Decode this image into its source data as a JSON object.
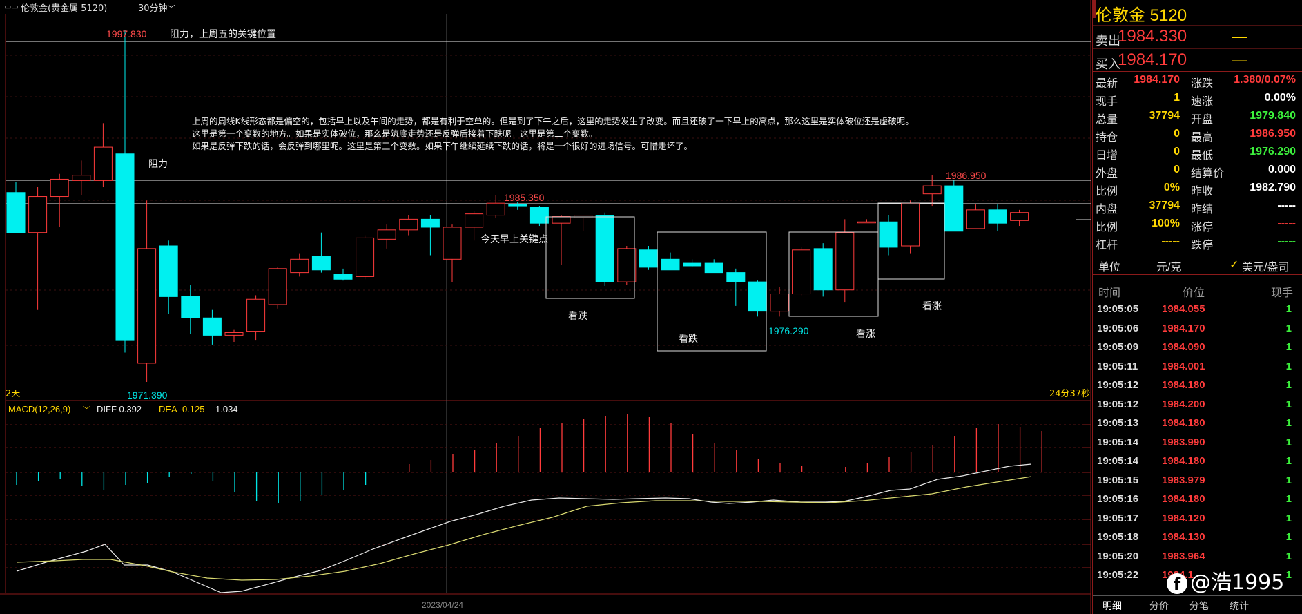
{
  "header": {
    "instrument_label": "伦敦金(贵金属  5120)",
    "period_label": "30分钟",
    "period_chevron_icon": "chevron-down-icon"
  },
  "main_chart": {
    "high_label": "1997.830",
    "low_label": "1971.390",
    "mid_high_label": "1985.350",
    "right_high_label": "1986.950",
    "right_low_label": "1976.290",
    "top_annotation": "阻力，上周五的关键位置",
    "resistance_label": "阻力",
    "key_point_label": "今天早上关键点",
    "bearish_label": "看跌",
    "bullish_label": "看涨",
    "commentary": [
      "上周的周线K线形态都是偏空的，包括早上以及午间的走势，都是有利于空单的。但是到了下午之后，这里的走势发生了改变。而且还破了一下早上的高点，那么这里是实体破位还是虚破呢。",
      "这里是第一个变数的地方。如果是实体破位，那么是筑底走势还是反弹后接着下跌呢。这里是第二个变数。",
      "如果是反弹下跌的话，会反弹到哪里呢。这里是第三个变数。如果下午继续延续下跌的话，将是一个很好的进场信号。可惜走坏了。"
    ],
    "left_bottom_label": "2天",
    "right_bottom_label": "24分37秒",
    "date_label": "2023/04/24",
    "colors": {
      "up": "#ff3b3b",
      "down": "#00f0f0",
      "text_red": "#ff4a4a",
      "text_cyan": "#00e5e5"
    }
  },
  "macd": {
    "title": "MACD(12,26,9)",
    "diff_label": "DIFF 0.392",
    "dea_label": "DEA -0.125",
    "macd_value": "1.034",
    "chevron_icon": "chevron-down-icon"
  },
  "side": {
    "title": "伦敦金  5120",
    "sell_label": "卖出",
    "sell_price": "1984.330",
    "sell_vol": "—",
    "buy_label": "买入",
    "buy_price": "1984.170",
    "buy_vol": "—",
    "quotes": [
      {
        "l1": "最新",
        "v1": "1984.170",
        "c1": "#ff3b3b",
        "l2": "涨跌",
        "v2": "1.380/0.07%",
        "c2": "#ff3b3b"
      },
      {
        "l1": "现手",
        "v1": "1",
        "c1": "#ffd700",
        "l2": "速涨",
        "v2": "0.00%",
        "c2": "#ffffff"
      },
      {
        "l1": "总量",
        "v1": "37794",
        "c1": "#ffd700",
        "l2": "开盘",
        "v2": "1979.840",
        "c2": "#3cf03c"
      },
      {
        "l1": "持仓",
        "v1": "0",
        "c1": "#ffd700",
        "l2": "最高",
        "v2": "1986.950",
        "c2": "#ff3b3b"
      },
      {
        "l1": "日增",
        "v1": "0",
        "c1": "#ffd700",
        "l2": "最低",
        "v2": "1976.290",
        "c2": "#3cf03c"
      },
      {
        "l1": "外盘",
        "v1": "0",
        "c1": "#ffd700",
        "l2": "结算价",
        "v2": "0.000",
        "c2": "#ffffff"
      },
      {
        "l1": "比例",
        "v1": "0%",
        "c1": "#ffd700",
        "l2": "昨收",
        "v2": "1982.790",
        "c2": "#ffffff"
      },
      {
        "l1": "内盘",
        "v1": "37794",
        "c1": "#ffd700",
        "l2": "昨结",
        "v2": "-----",
        "c2": "#ffffff"
      },
      {
        "l1": "比例",
        "v1": "100%",
        "c1": "#ffd700",
        "l2": "涨停",
        "v2": "-----",
        "c2": "#ff3b3b"
      },
      {
        "l1": "杠杆",
        "v1": "-----",
        "c1": "#ffd700",
        "l2": "跌停",
        "v2": "-----",
        "c2": "#3cf03c"
      }
    ],
    "unit_label": "单位",
    "unit_value": "元/克",
    "unit_check_icon": "checkmark-icon",
    "unit_alt": "美元/盎司",
    "tick_header": {
      "time": "时间",
      "price": "价位",
      "vol": "现手"
    },
    "ticks": [
      {
        "time": "19:05:05",
        "price": "1984.055",
        "vol": "1"
      },
      {
        "time": "19:05:06",
        "price": "1984.170",
        "vol": "1"
      },
      {
        "time": "19:05:09",
        "price": "1984.090",
        "vol": "1"
      },
      {
        "time": "19:05:11",
        "price": "1984.001",
        "vol": "1"
      },
      {
        "time": "19:05:12",
        "price": "1984.180",
        "vol": "1"
      },
      {
        "time": "19:05:12",
        "price": "1984.200",
        "vol": "1"
      },
      {
        "time": "19:05:13",
        "price": "1984.180",
        "vol": "1"
      },
      {
        "time": "19:05:14",
        "price": "1983.990",
        "vol": "1"
      },
      {
        "time": "19:05:14",
        "price": "1984.180",
        "vol": "1"
      },
      {
        "time": "19:05:15",
        "price": "1983.979",
        "vol": "1"
      },
      {
        "time": "19:05:16",
        "price": "1984.180",
        "vol": "1"
      },
      {
        "time": "19:05:17",
        "price": "1984.120",
        "vol": "1"
      },
      {
        "time": "19:05:18",
        "price": "1984.130",
        "vol": "1"
      },
      {
        "time": "19:05:20",
        "price": "1983.964",
        "vol": "1"
      },
      {
        "time": "19:05:22",
        "price": "1984.1",
        "vol": "1"
      }
    ],
    "tabs": [
      "明细",
      "分价",
      "分笔",
      "统计"
    ]
  },
  "watermark": {
    "icon": "facebook-icon",
    "text": "@浩1995"
  },
  "chart_data": {
    "type": "candlestick",
    "title": "",
    "timeframe": "30分钟",
    "ylim": [
      1970,
      1999
    ],
    "date_tick": "2023/04/24",
    "candles": [
      {
        "o": 1985.6,
        "h": 1986.4,
        "l": 1983.9,
        "c": 1982.6
      },
      {
        "o": 1982.6,
        "h": 1986.0,
        "l": 1976.8,
        "c": 1985.3
      },
      {
        "o": 1985.3,
        "h": 1987.0,
        "l": 1983.0,
        "c": 1986.6
      },
      {
        "o": 1986.5,
        "h": 1988.0,
        "l": 1985.4,
        "c": 1986.9
      },
      {
        "o": 1986.5,
        "h": 1990.8,
        "l": 1986.0,
        "c": 1989.0
      },
      {
        "o": 1988.5,
        "h": 1997.8,
        "l": 1973.6,
        "c": 1974.5
      },
      {
        "o": 1972.8,
        "h": 1985.0,
        "l": 1971.4,
        "c": 1981.4
      },
      {
        "o": 1981.6,
        "h": 1982.0,
        "l": 1976.5,
        "c": 1977.8
      },
      {
        "o": 1977.8,
        "h": 1978.7,
        "l": 1975.0,
        "c": 1976.2
      },
      {
        "o": 1976.2,
        "h": 1976.8,
        "l": 1974.2,
        "c": 1974.9
      },
      {
        "o": 1974.9,
        "h": 1975.3,
        "l": 1974.4,
        "c": 1975.1
      },
      {
        "o": 1975.2,
        "h": 1977.9,
        "l": 1974.5,
        "c": 1977.6
      },
      {
        "o": 1977.2,
        "h": 1980.0,
        "l": 1976.9,
        "c": 1979.9
      },
      {
        "o": 1979.6,
        "h": 1981.0,
        "l": 1979.3,
        "c": 1980.6
      },
      {
        "o": 1980.8,
        "h": 1982.6,
        "l": 1979.6,
        "c": 1979.8
      },
      {
        "o": 1979.5,
        "h": 1979.9,
        "l": 1979.0,
        "c": 1979.1
      },
      {
        "o": 1979.3,
        "h": 1982.4,
        "l": 1979.1,
        "c": 1982.2
      },
      {
        "o": 1982.1,
        "h": 1983.2,
        "l": 1981.4,
        "c": 1982.8
      },
      {
        "o": 1982.8,
        "h": 1983.9,
        "l": 1982.4,
        "c": 1983.6
      },
      {
        "o": 1983.6,
        "h": 1983.9,
        "l": 1980.9,
        "c": 1983.0
      },
      {
        "o": 1980.6,
        "h": 1983.2,
        "l": 1978.9,
        "c": 1983.0
      },
      {
        "o": 1983.0,
        "h": 1984.2,
        "l": 1982.0,
        "c": 1984.0
      },
      {
        "o": 1983.9,
        "h": 1985.4,
        "l": 1983.7,
        "c": 1984.8
      },
      {
        "o": 1984.7,
        "h": 1984.9,
        "l": 1984.3,
        "c": 1984.6
      },
      {
        "o": 1984.5,
        "h": 1984.6,
        "l": 1983.1,
        "c": 1983.3
      },
      {
        "o": 1983.3,
        "h": 1983.9,
        "l": 1980.2,
        "c": 1983.8
      },
      {
        "o": 1983.7,
        "h": 1983.9,
        "l": 1982.7,
        "c": 1983.9
      },
      {
        "o": 1983.9,
        "h": 1984.1,
        "l": 1978.6,
        "c": 1978.9
      },
      {
        "o": 1978.9,
        "h": 1981.6,
        "l": 1978.7,
        "c": 1981.4
      },
      {
        "o": 1981.3,
        "h": 1981.6,
        "l": 1979.8,
        "c": 1980.0
      },
      {
        "o": 1980.6,
        "h": 1981.1,
        "l": 1979.8,
        "c": 1979.8
      },
      {
        "o": 1980.3,
        "h": 1980.6,
        "l": 1980.0,
        "c": 1980.1
      },
      {
        "o": 1980.3,
        "h": 1980.6,
        "l": 1979.6,
        "c": 1979.6
      },
      {
        "o": 1979.6,
        "h": 1979.9,
        "l": 1977.1,
        "c": 1978.9
      },
      {
        "o": 1978.9,
        "h": 1979.0,
        "l": 1976.3,
        "c": 1976.7
      },
      {
        "o": 1976.7,
        "h": 1978.5,
        "l": 1976.3,
        "c": 1978.0
      },
      {
        "o": 1978.0,
        "h": 1981.5,
        "l": 1977.9,
        "c": 1981.3
      },
      {
        "o": 1981.4,
        "h": 1981.8,
        "l": 1977.8,
        "c": 1978.3
      },
      {
        "o": 1978.3,
        "h": 1983.6,
        "l": 1977.4,
        "c": 1982.6
      },
      {
        "o": 1983.4,
        "h": 1983.6,
        "l": 1983.4,
        "c": 1983.4
      },
      {
        "o": 1983.4,
        "h": 1983.9,
        "l": 1980.9,
        "c": 1981.5
      },
      {
        "o": 1981.6,
        "h": 1985.0,
        "l": 1981.0,
        "c": 1984.8
      },
      {
        "o": 1985.5,
        "h": 1986.9,
        "l": 1984.6,
        "c": 1986.1
      },
      {
        "o": 1986.1,
        "h": 1986.5,
        "l": 1982.7,
        "c": 1982.7
      },
      {
        "o": 1982.9,
        "h": 1984.7,
        "l": 1982.9,
        "c": 1984.3
      },
      {
        "o": 1984.3,
        "h": 1984.7,
        "l": 1982.7,
        "c": 1983.3
      },
      {
        "o": 1983.5,
        "h": 1984.3,
        "l": 1983.1,
        "c": 1984.1
      }
    ],
    "macd": {
      "diff": 0.392,
      "dea": -0.125,
      "macd": 1.034
    }
  }
}
